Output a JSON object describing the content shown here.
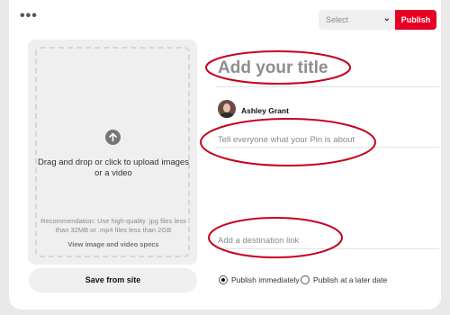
{
  "toolbar": {
    "more_label": "•••",
    "select_placeholder": "Select",
    "select_icon": "chevron-down-icon",
    "publish_label": "Publish"
  },
  "upload": {
    "icon": "upload-arrow-icon",
    "main_text": "Drag and drop or click to upload images or a video",
    "recommendation": "Recommendation: Use high-quality .jpg files less than 32MB or .mp4 files less than 2GB",
    "specs_link": "View image and video specs"
  },
  "save_from_site_label": "Save from site",
  "form": {
    "title_placeholder": "Add your title",
    "user_name": "Ashley Grant",
    "description_placeholder": "Tell everyone what your Pin is about",
    "link_placeholder": "Add a destination link"
  },
  "publish_options": [
    {
      "label": "Publish immediately",
      "checked": true
    },
    {
      "label": "Publish at a later date",
      "checked": false
    }
  ],
  "colors": {
    "accent": "#e60023",
    "annotation": "#c8001e"
  }
}
